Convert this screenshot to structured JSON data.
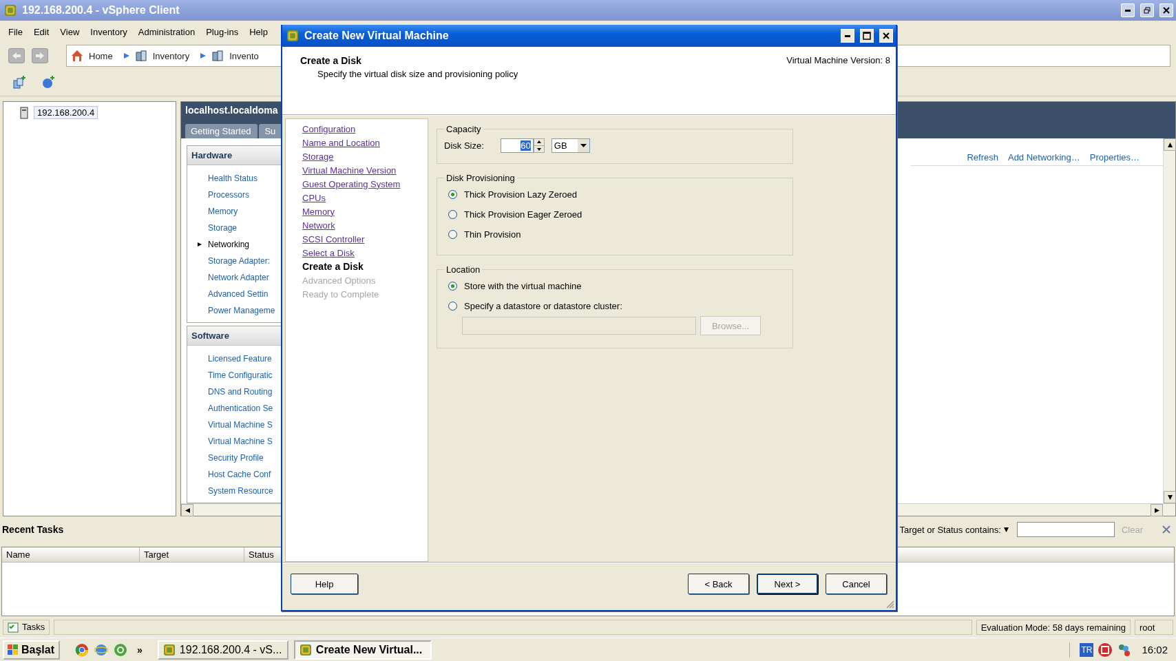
{
  "window": {
    "title": "192.168.200.4 - vSphere Client"
  },
  "menu": [
    "File",
    "Edit",
    "View",
    "Inventory",
    "Administration",
    "Plug-ins",
    "Help"
  ],
  "breadcrumbs": [
    "Home",
    "Inventory",
    "Invento"
  ],
  "inventory_tree": {
    "items": [
      {
        "label": "192.168.200.4",
        "selected": true
      }
    ]
  },
  "host_panel": {
    "title": "localhost.localdoma",
    "tabs": [
      {
        "label": "Getting Started",
        "selected": false
      },
      {
        "label": "Su",
        "selected": false
      }
    ],
    "sections": [
      {
        "title": "Hardware",
        "items": [
          {
            "label": "Health Status",
            "selected": false
          },
          {
            "label": "Processors",
            "selected": false
          },
          {
            "label": "Memory",
            "selected": false
          },
          {
            "label": "Storage",
            "selected": false
          },
          {
            "label": "Networking",
            "selected": true
          },
          {
            "label": "Storage Adapter:",
            "selected": false
          },
          {
            "label": "Network Adapter",
            "selected": false
          },
          {
            "label": "Advanced Settin",
            "selected": false
          },
          {
            "label": "Power Manageme",
            "selected": false
          }
        ]
      },
      {
        "title": "Software",
        "items": [
          {
            "label": "Licensed Feature",
            "selected": false
          },
          {
            "label": "Time Configuratic",
            "selected": false
          },
          {
            "label": "DNS and Routing",
            "selected": false
          },
          {
            "label": "Authentication Se",
            "selected": false
          },
          {
            "label": "Virtual Machine S",
            "selected": false
          },
          {
            "label": "Virtual Machine S",
            "selected": false
          },
          {
            "label": "Security Profile",
            "selected": false
          },
          {
            "label": "Host Cache Conf",
            "selected": false
          },
          {
            "label": "System Resource",
            "selected": false
          }
        ]
      }
    ],
    "actions": [
      "Refresh",
      "Add Networking…",
      "Properties…"
    ]
  },
  "recent_tasks": {
    "title": "Recent Tasks",
    "filter_label": "Target or Status contains:",
    "clear": {
      "label": "Clear",
      "disabled": true
    },
    "columns": [
      "Name",
      "Target",
      "Status"
    ]
  },
  "status_bar": {
    "tasks_button": "Tasks",
    "evaluation": "Evaluation Mode: 58 days remaining",
    "user": "root"
  },
  "taskbar": {
    "start": "Başlat",
    "more": "»",
    "tasks": [
      {
        "label": "192.168.200.4 - vS...",
        "selected": false
      },
      {
        "label": "Create New Virtual...",
        "selected": true
      }
    ],
    "language": "TR",
    "clock": "16:02"
  },
  "dialog": {
    "title": "Create New Virtual Machine",
    "heading": "Create a Disk",
    "subheading": "Specify the virtual disk size and provisioning policy",
    "version": "Virtual Machine Version: 8",
    "steps": [
      {
        "label": "Configuration",
        "kind": "link"
      },
      {
        "label": "Name and Location",
        "kind": "link"
      },
      {
        "label": "Storage",
        "kind": "link"
      },
      {
        "label": "Virtual Machine Version",
        "kind": "link"
      },
      {
        "label": "Guest Operating System",
        "kind": "link"
      },
      {
        "label": "CPUs",
        "kind": "link"
      },
      {
        "label": "Memory",
        "kind": "link"
      },
      {
        "label": "Network",
        "kind": "link"
      },
      {
        "label": "SCSI Controller",
        "kind": "link"
      },
      {
        "label": "Select a Disk",
        "kind": "link"
      },
      {
        "label": "Create a Disk",
        "kind": "current"
      },
      {
        "label": "Advanced Options",
        "kind": "pending"
      },
      {
        "label": "Ready to Complete",
        "kind": "pending"
      }
    ],
    "capacity": {
      "title": "Capacity",
      "label": "Disk Size:",
      "value": "60",
      "unit": "GB"
    },
    "provisioning": {
      "title": "Disk Provisioning",
      "options": [
        {
          "label": "Thick Provision Lazy Zeroed",
          "selected": true
        },
        {
          "label": "Thick Provision Eager Zeroed",
          "selected": false
        },
        {
          "label": "Thin Provision",
          "selected": false
        }
      ]
    },
    "location": {
      "title": "Location",
      "options": [
        {
          "label": "Store with the virtual machine",
          "selected": true
        },
        {
          "label": "Specify a datastore or datastore cluster:",
          "selected": false
        }
      ],
      "path_disabled": true,
      "browse": {
        "label": "Browse...",
        "disabled": true
      }
    },
    "help": "Help",
    "buttons": [
      {
        "label": "< Back",
        "default": false
      },
      {
        "label": "Next >",
        "default": true
      },
      {
        "label": "Cancel",
        "default": false
      }
    ]
  }
}
